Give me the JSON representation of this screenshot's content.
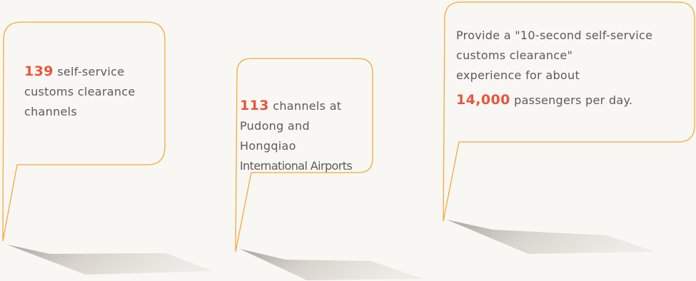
{
  "colors": {
    "background": "#f9f7f3",
    "outline": "#f2a93b",
    "highlight": "#e8553b",
    "text": "#5b5b5b",
    "shadow": "#d6d2ca"
  },
  "callouts": [
    {
      "number": "139",
      "lines": [
        "self-service",
        "customs clearance",
        "channels"
      ]
    },
    {
      "number": "113",
      "lines": [
        "channels at",
        "Pudong and",
        "Hongqiao",
        "International Airports"
      ]
    },
    {
      "intro_lines": [
        "Provide a \"10-second self-service",
        "customs clearance\"",
        "experience for about"
      ],
      "number": "14,000",
      "suffix": "passengers per day."
    }
  ]
}
